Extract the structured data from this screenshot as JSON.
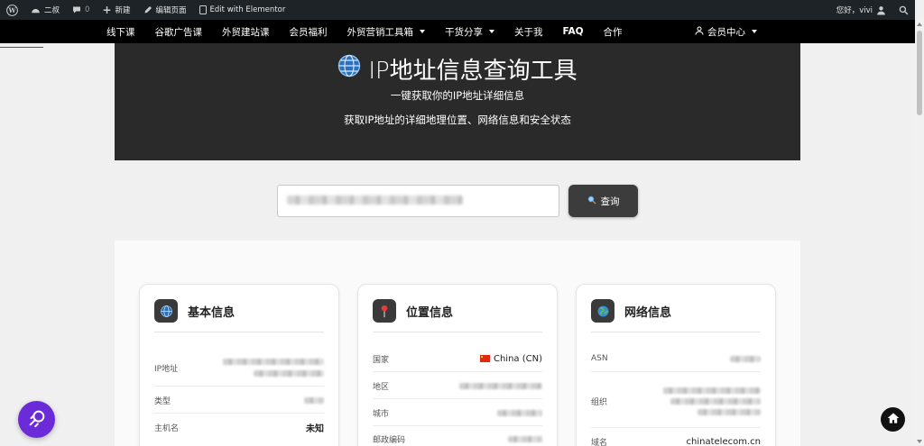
{
  "adminbar": {
    "site_name": "二叔",
    "comments_count": "0",
    "new_label": "新建",
    "edit_label": "编辑页面",
    "elementor_label": "Edit with Elementor",
    "greeting": "您好，vivi"
  },
  "nav": {
    "items": [
      {
        "label": "线下课"
      },
      {
        "label": "谷歌广告课"
      },
      {
        "label": "外贸建站课"
      },
      {
        "label": "会员福利"
      },
      {
        "label": "外贸营销工具箱"
      },
      {
        "label": "干货分享"
      },
      {
        "label": "关于我"
      },
      {
        "label": "FAQ"
      },
      {
        "label": "合作"
      }
    ],
    "member_label": "会员中心"
  },
  "hero": {
    "title": "IP地址信息查询工具",
    "subtitle": "一键获取你的IP地址详细信息",
    "description": "获取IP地址的详细地理位置、网络信息和安全状态"
  },
  "search": {
    "button_label": "查询"
  },
  "cards": {
    "basic": {
      "title": "基本信息",
      "ip_label": "IP地址",
      "type_label": "类型",
      "host_label": "主机名",
      "host_value": "未知"
    },
    "location": {
      "title": "位置信息",
      "country_label": "国家",
      "country_value": "China (CN)",
      "region_label": "地区",
      "city_label": "城市",
      "postal_label": "邮政编码"
    },
    "network": {
      "title": "网络信息",
      "asn_label": "ASN",
      "org_label": "组织",
      "domain_label": "域名",
      "domain_value": "chinatelecom.cn"
    }
  },
  "colors": {
    "adminbar": "#1d2327",
    "nav": "#000000",
    "hero": "#2a2a2a",
    "fab": "#6c2bd9"
  }
}
